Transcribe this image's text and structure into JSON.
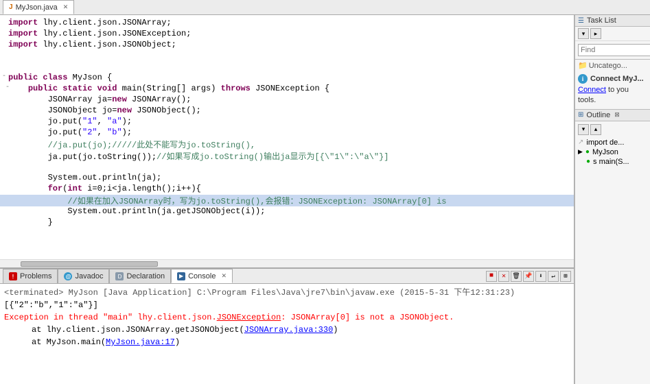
{
  "tabs": {
    "editor_tab": "MyJson.java"
  },
  "right_panel": {
    "task_list_title": "Task List",
    "find_placeholder": "Find",
    "uncategorized": "Uncatego...",
    "connect_title": "Connect MyJ...",
    "connect_text": "Connect to you tools.",
    "connect_link": "Connect",
    "outline_title": "Outline",
    "outline_items": [
      {
        "label": "import de...",
        "type": "import"
      },
      {
        "label": "MyJson",
        "type": "class"
      },
      {
        "label": "main(S...",
        "type": "method"
      }
    ]
  },
  "code": {
    "lines": [
      {
        "num": "",
        "indent": "    ",
        "text": "import lhy.client.json.JSONArray;"
      },
      {
        "num": "",
        "indent": "    ",
        "text": "import lhy.client.json.JSONException;"
      },
      {
        "num": "",
        "indent": "    ",
        "text": "import lhy.client.json.JSONObject;"
      },
      {
        "num": "",
        "indent": "",
        "text": ""
      },
      {
        "num": "",
        "indent": "",
        "text": ""
      },
      {
        "num": "",
        "indent": "    ",
        "text": "public class MyJson {"
      },
      {
        "num": "fold",
        "indent": "        ",
        "text": "public static void main(String[] args) throws JSONException {"
      },
      {
        "num": "",
        "indent": "            ",
        "text": "JSONArray ja=new JSONArray();"
      },
      {
        "num": "",
        "indent": "            ",
        "text": "JSONObject jo=new JSONObject();"
      },
      {
        "num": "",
        "indent": "            ",
        "text": "jo.put(\"1\", \"a\");"
      },
      {
        "num": "",
        "indent": "            ",
        "text": "jo.put(\"2\", \"b\");"
      },
      {
        "num": "",
        "indent": "            ",
        "text": "//ja.put(jo);/////此处不能写为jo.toString(),"
      },
      {
        "num": "",
        "indent": "            ",
        "text": "ja.put(jo.toString());//如果写成jo.toString()输出ja显示为[{\"1\":\"a\"}]"
      },
      {
        "num": "",
        "indent": "",
        "text": ""
      },
      {
        "num": "",
        "indent": "            ",
        "text": "System.out.println(ja);"
      },
      {
        "num": "",
        "indent": "            ",
        "text": "for(int i=0;i<ja.length();i++){"
      },
      {
        "num": "highlighted",
        "indent": "                ",
        "text": "//如果在加入JSONArray时，写为jo.toString(),会报错：JSONException: JSONArray[0] is"
      },
      {
        "num": "",
        "indent": "                ",
        "text": "System.out.println(ja.getJSONObject(i));"
      },
      {
        "num": "",
        "indent": "            ",
        "text": "}"
      }
    ]
  },
  "bottom": {
    "tabs": [
      {
        "label": "Problems",
        "icon": "problems",
        "active": false
      },
      {
        "label": "Javadoc",
        "icon": "javadoc",
        "active": false
      },
      {
        "label": "Declaration",
        "icon": "declaration",
        "active": false
      },
      {
        "label": "Console",
        "icon": "console",
        "active": true
      }
    ],
    "console": {
      "terminated_line": "<terminated> MyJson [Java Application] C:\\Program Files\\Java\\jre7\\bin\\javaw.exe (2015-5-31 下午12:31:23)",
      "output_line": "[{\"2\":\"b\",\"1\":\"a\"}]",
      "error_line": "Exception in thread \"main\" lhy.client.json.JSONException: JSONArray[0] is not a JSONObject.",
      "trace_line1": "at lhy.client.json.JSONArray.getJSONObject(JSONArray.java:330)",
      "trace_line2": "at MyJson.main(MyJson.java:17)",
      "trace_link1": "JSONArray.java:330",
      "trace_link2": "MyJson.java:17"
    }
  }
}
